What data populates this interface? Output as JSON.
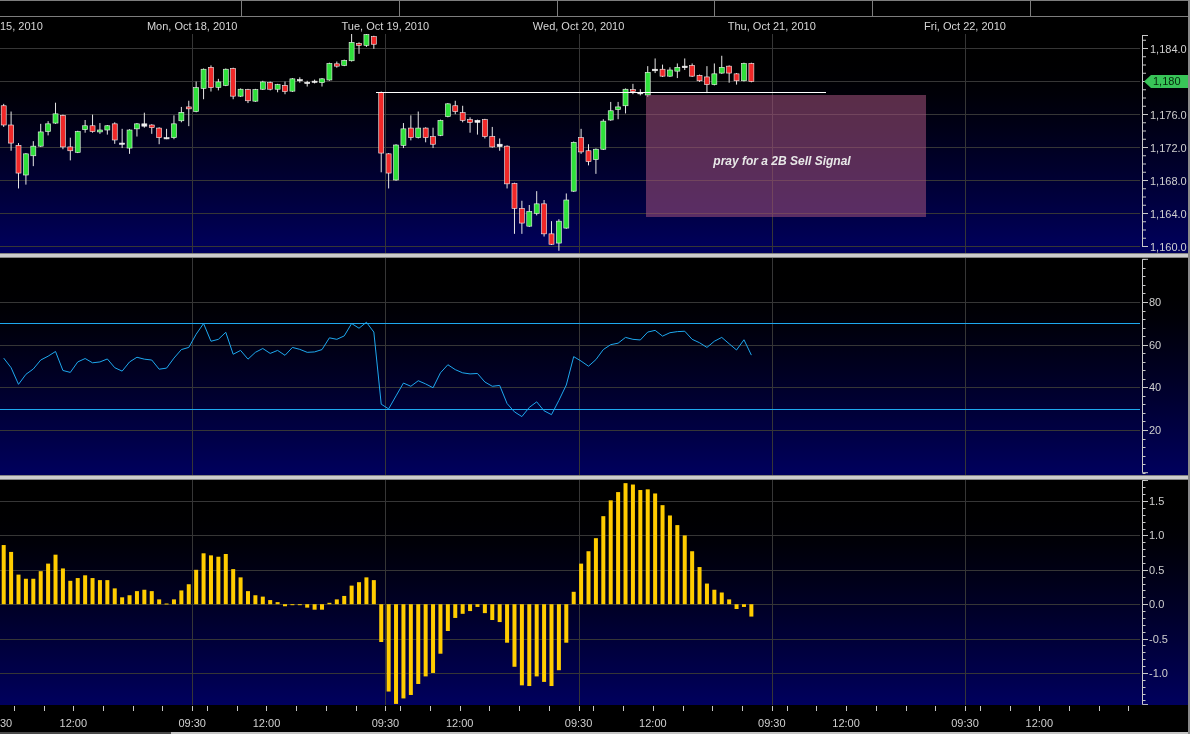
{
  "date_axis": {
    "labels": [
      "15, 2010",
      "Mon, Oct 18, 2010",
      "Tue, Oct 19, 2010",
      "Wed, Oct 20, 2010",
      "Thu, Oct 21, 2010",
      "Fri, Oct 22, 2010"
    ]
  },
  "price_panel": {
    "axis_labels": [
      "1,184.0",
      "1,176.0",
      "1,172.0",
      "1,168.0",
      "1,164.0",
      "1,160.0"
    ],
    "last_price": "1,180",
    "annotation": "pray for a 2B Sell Signal"
  },
  "oscillator_panel": {
    "chart_data": {
      "type": "line",
      "grid": true,
      "ylim": [
        0,
        100
      ],
      "yticks": [
        {
          "value": 20,
          "label": "20"
        },
        {
          "value": 40,
          "label": "40"
        },
        {
          "value": 60,
          "label": "60"
        },
        {
          "value": 80,
          "label": "80"
        }
      ],
      "ref_lines": [
        {
          "axis": "y",
          "value": 70
        },
        {
          "axis": "y",
          "value": 30
        }
      ],
      "categories": [
        null,
        null,
        null,
        null,
        null,
        null,
        null,
        null,
        null,
        null,
        null,
        null,
        null,
        null,
        null,
        null,
        null,
        null,
        null,
        null,
        null,
        null,
        null,
        null,
        null,
        null,
        null,
        null,
        null,
        null,
        null,
        null,
        null,
        null,
        null,
        null,
        null,
        null,
        null,
        null,
        null,
        null,
        null,
        null,
        null,
        null,
        null,
        null,
        null,
        null,
        null,
        null,
        null,
        null,
        null,
        null,
        null,
        null,
        null,
        null,
        null,
        null,
        null,
        null,
        null,
        null,
        null,
        null,
        null,
        null,
        null,
        null,
        null,
        null,
        null,
        null,
        null,
        null,
        null,
        null,
        null,
        null,
        null,
        null,
        null,
        null,
        null,
        null,
        null,
        null,
        null,
        null,
        null,
        null,
        null,
        null,
        null,
        null,
        null,
        null,
        null,
        null,
        null,
        null,
        null,
        null,
        null,
        null,
        null,
        null,
        null,
        null,
        null,
        null,
        null,
        null,
        null,
        null,
        null,
        null,
        null,
        null,
        null,
        null,
        null,
        null,
        null,
        null,
        null,
        null,
        null,
        null,
        null,
        null,
        null,
        null,
        null,
        null,
        null,
        null,
        null,
        null,
        null,
        null,
        null,
        null,
        null,
        null,
        null,
        null,
        null,
        null,
        null,
        null
      ],
      "values": [
        53.7,
        49.2,
        41.4,
        46.1,
        48.6,
        52.8,
        54.6,
        56.8,
        47.9,
        47.0,
        51.9,
        53.5,
        51.5,
        51.9,
        53.3,
        49.2,
        47.6,
        51.9,
        54.1,
        53.2,
        52.8,
        48.5,
        49.0,
        53.7,
        57.7,
        58.7,
        64.9,
        69.9,
        61.6,
        62.5,
        65.8,
        55.5,
        57.3,
        53.2,
        56.4,
        58.2,
        55.9,
        57.3,
        55.0,
        58.7,
        57.8,
        56.4,
        56.6,
        57.7,
        63.2,
        62.5,
        64.1,
        69.9,
        67.7,
        70.5,
        65.9,
        32.1,
        29.9,
        36.0,
        42.0,
        40.5,
        43.1,
        41.6,
        39.8,
        46.8,
        50.6,
        48.3,
        46.8,
        46.3,
        46.5,
        42.5,
        40.5,
        40.9,
        32.4,
        28.5,
        26.3,
        30.6,
        33.2,
        29.0,
        27.2,
        33.9,
        41.1,
        54.4,
        52.3,
        49.9,
        53.0,
        57.7,
        60.0,
        60.7,
        63.4,
        62.5,
        62.2,
        65.9,
        66.7,
        64.0,
        65.6,
        66.1,
        66.3,
        62.5,
        60.9,
        58.7,
        61.6,
        63.4,
        60.4,
        57.5,
        62.3,
        55.1,
        null,
        null,
        null,
        null,
        null,
        null,
        null,
        null,
        null,
        null,
        null,
        null,
        null,
        null,
        null,
        null,
        null,
        null,
        null,
        null,
        null,
        null,
        null,
        null,
        null,
        null,
        null,
        null,
        null,
        null,
        null,
        null,
        null,
        null,
        null,
        null,
        null,
        null,
        null,
        null,
        null,
        null,
        null,
        null,
        null,
        null,
        null,
        null,
        null,
        null,
        null,
        null
      ]
    }
  },
  "histogram_panel": {
    "chart_data": {
      "type": "bar",
      "grid": true,
      "ylim": [
        -1.46,
        1.8
      ],
      "yticks": [
        {
          "value": -1,
          "label": "-1.0"
        },
        {
          "value": -0.5,
          "label": "-0.5"
        },
        {
          "value": 0,
          "label": "0.0"
        },
        {
          "value": 0.5,
          "label": "0.5"
        },
        {
          "value": 1,
          "label": "1.0"
        },
        {
          "value": 1.5,
          "label": "1.5"
        }
      ],
      "categories": [
        null,
        null,
        null,
        null,
        null,
        null,
        null,
        null,
        null,
        null,
        null,
        null,
        null,
        null,
        null,
        null,
        null,
        null,
        null,
        null,
        null,
        null,
        null,
        null,
        null,
        null,
        null,
        null,
        null,
        null,
        null,
        null,
        null,
        null,
        null,
        null,
        null,
        null,
        null,
        null,
        null,
        null,
        null,
        null,
        null,
        null,
        null,
        null,
        null,
        null,
        null,
        null,
        null,
        null,
        null,
        null,
        null,
        null,
        null,
        null,
        null,
        null,
        null,
        null,
        null,
        null,
        null,
        null,
        null,
        null,
        null,
        null,
        null,
        null,
        null,
        null,
        null,
        null,
        null,
        null,
        null,
        null,
        null,
        null,
        null,
        null,
        null,
        null,
        null,
        null,
        null,
        null,
        null,
        null,
        null,
        null,
        null,
        null,
        null,
        null,
        null,
        null,
        null,
        null,
        null,
        null,
        null,
        null,
        null,
        null,
        null,
        null,
        null,
        null,
        null,
        null,
        null,
        null,
        null,
        null,
        null,
        null,
        null,
        null,
        null,
        null,
        null,
        null,
        null,
        null,
        null,
        null,
        null,
        null,
        null,
        null,
        null,
        null,
        null,
        null,
        null,
        null,
        null,
        null,
        null,
        null,
        null,
        null,
        null,
        null,
        null,
        null,
        null,
        null
      ],
      "values": [
        0.86,
        0.76,
        0.43,
        0.37,
        0.37,
        0.48,
        0.59,
        0.72,
        0.52,
        0.34,
        0.38,
        0.42,
        0.38,
        0.35,
        0.35,
        0.23,
        0.1,
        0.13,
        0.19,
        0.21,
        0.19,
        0.07,
        0.01,
        0.07,
        0.2,
        0.29,
        0.5,
        0.74,
        0.71,
        0.69,
        0.73,
        0.51,
        0.39,
        0.19,
        0.13,
        0.11,
        0.06,
        0.03,
        -0.03,
        -0.01,
        -0.01,
        -0.05,
        -0.08,
        -0.08,
        0.02,
        0.07,
        0.12,
        0.27,
        0.32,
        0.39,
        0.35,
        -0.55,
        -1.27,
        -1.45,
        -1.37,
        -1.32,
        -1.16,
        -1.05,
        -1.0,
        -0.72,
        -0.39,
        -0.2,
        -0.14,
        -0.1,
        -0.04,
        -0.13,
        -0.23,
        -0.26,
        -0.56,
        -0.91,
        -1.18,
        -1.19,
        -1.05,
        -1.13,
        -1.19,
        -0.96,
        -0.56,
        0.18,
        0.59,
        0.77,
        0.96,
        1.28,
        1.51,
        1.63,
        1.76,
        1.74,
        1.66,
        1.67,
        1.61,
        1.44,
        1.29,
        1.15,
        1.0,
        0.77,
        0.54,
        0.3,
        0.21,
        0.17,
        0.07,
        -0.07,
        -0.04,
        -0.18,
        null,
        null,
        null,
        null,
        null,
        null,
        null,
        null,
        null,
        null,
        null,
        null,
        null,
        null,
        null,
        null,
        null,
        null,
        null,
        null,
        null,
        null,
        null,
        null,
        null,
        null,
        null,
        null,
        null,
        null,
        null,
        null,
        null,
        null,
        null,
        null,
        null,
        null,
        null,
        null,
        null,
        null,
        null,
        null,
        null,
        null,
        null,
        null,
        null,
        null,
        null,
        null
      ]
    }
  },
  "time_axis": {
    "labels": [
      "30",
      "12:00",
      "09:30",
      "12:00",
      "09:30",
      "12:00",
      "09:30",
      "12:00",
      "09:30",
      "12:00",
      "09:30",
      "12:00"
    ]
  }
}
